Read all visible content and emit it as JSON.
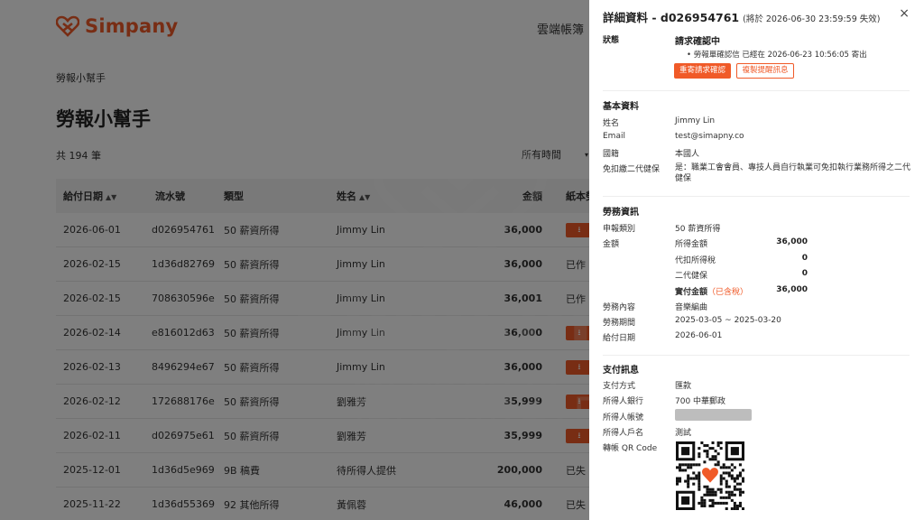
{
  "app": {
    "logo_text": "Simpany",
    "nav_item": "雲端帳簿",
    "breadcrumb": "勞報小幫手",
    "page_title": "勞報小幫手",
    "record_count": "共 194 筆",
    "time_filter": "所有時間",
    "brand_color": "#f05a28"
  },
  "table": {
    "headers": {
      "date": "給付日期",
      "serial": "流水號",
      "type": "類型",
      "name": "姓名",
      "amount": "金額",
      "pay": "紙本勞"
    },
    "rows": [
      {
        "date": "2026-06-01",
        "serial": "d026954761",
        "type": "50 薪資所得",
        "name": "Jimmy Lin",
        "amount": "36,000",
        "pay": "⭳"
      },
      {
        "date": "2026-02-15",
        "serial": "1d36d82769",
        "type": "50 薪資所得",
        "name": "Jimmy Lin",
        "amount": "36,000",
        "pay": "已作"
      },
      {
        "date": "2026-02-15",
        "serial": "708630596e",
        "type": "50 薪資所得",
        "name": "Jimmy Lin",
        "amount": "36,001",
        "pay": "已作"
      },
      {
        "date": "2026-02-14",
        "serial": "e816012d63",
        "type": "50 薪資所得",
        "name": "Jimmy Lin",
        "amount": "36,000",
        "pay": "⭳"
      },
      {
        "date": "2026-02-13",
        "serial": "8496294e67",
        "type": "50 薪資所得",
        "name": "Jimmy Lin",
        "amount": "36,000",
        "pay": "⭳"
      },
      {
        "date": "2026-02-12",
        "serial": "172688176e",
        "type": "50 薪資所得",
        "name": "劉雅芳",
        "amount": "35,999",
        "pay": "⭳"
      },
      {
        "date": "2026-02-11",
        "serial": "d026975e61",
        "type": "50 薪資所得",
        "name": "劉雅芳",
        "amount": "35,999",
        "pay": "⭳"
      },
      {
        "date": "2025-12-01",
        "serial": "1d36d5e969",
        "type": "9B 稿費",
        "name": "待所得人提供",
        "amount": "200,000",
        "pay": "已失"
      },
      {
        "date": "2025-11-22",
        "serial": "1d36d55369",
        "type": "92 其他所得",
        "name": "黃佩蓉",
        "amount": "46,000",
        "pay": "已失"
      }
    ]
  },
  "drawer": {
    "title": "詳細資料 - d026954761",
    "subtitle": "(將於 2026-06-30 23:59:59 失效)",
    "close": "×",
    "status_label": "狀態",
    "status_value": "請求確認中",
    "status_bullet": "勞報單確認信 已經在 2026-06-23 10:56:05 寄出",
    "resend_button": "重寄請求確認",
    "copy_button": "複製提醒訊息",
    "basic": {
      "section": "基本資料",
      "name_label": "姓名",
      "name_value": "Jimmy Lin",
      "email_label": "Email",
      "email_value": "test@simapny.co",
      "nationality_label": "國籍",
      "nationality_value": "本國人",
      "nhi_label": "免扣繳二代健保",
      "nhi_value": "是：職業工會會員、專技人員自行執業可免扣執行業務所得之二代健保"
    },
    "labor": {
      "section": "勞務資訊",
      "category_label": "申報類別",
      "category_value": "50 薪資所得",
      "amount_label": "金額",
      "income_label": "所得金額",
      "income_value": "36,000",
      "tax_label": "代扣所得稅",
      "tax_value": "0",
      "nhi2_label": "二代健保",
      "nhi2_value": "0",
      "net_label": "實付金額",
      "net_note": "（已含稅）",
      "net_value": "36,000",
      "content_label": "勞務內容",
      "content_value": "音樂編曲",
      "period_label": "勞務期間",
      "period_value": "2025-03-05 ~ 2025-03-20",
      "paydate_label": "給付日期",
      "paydate_value": "2026-06-01"
    },
    "payment": {
      "section": "支付訊息",
      "method_label": "支付方式",
      "method_value": "匯款",
      "bank_label": "所得人銀行",
      "bank_value": "700 中華郵政",
      "account_label": "所得人帳號",
      "holder_label": "所得人戶名",
      "holder_value": "測試",
      "qr_label": "轉帳 QR Code"
    }
  }
}
